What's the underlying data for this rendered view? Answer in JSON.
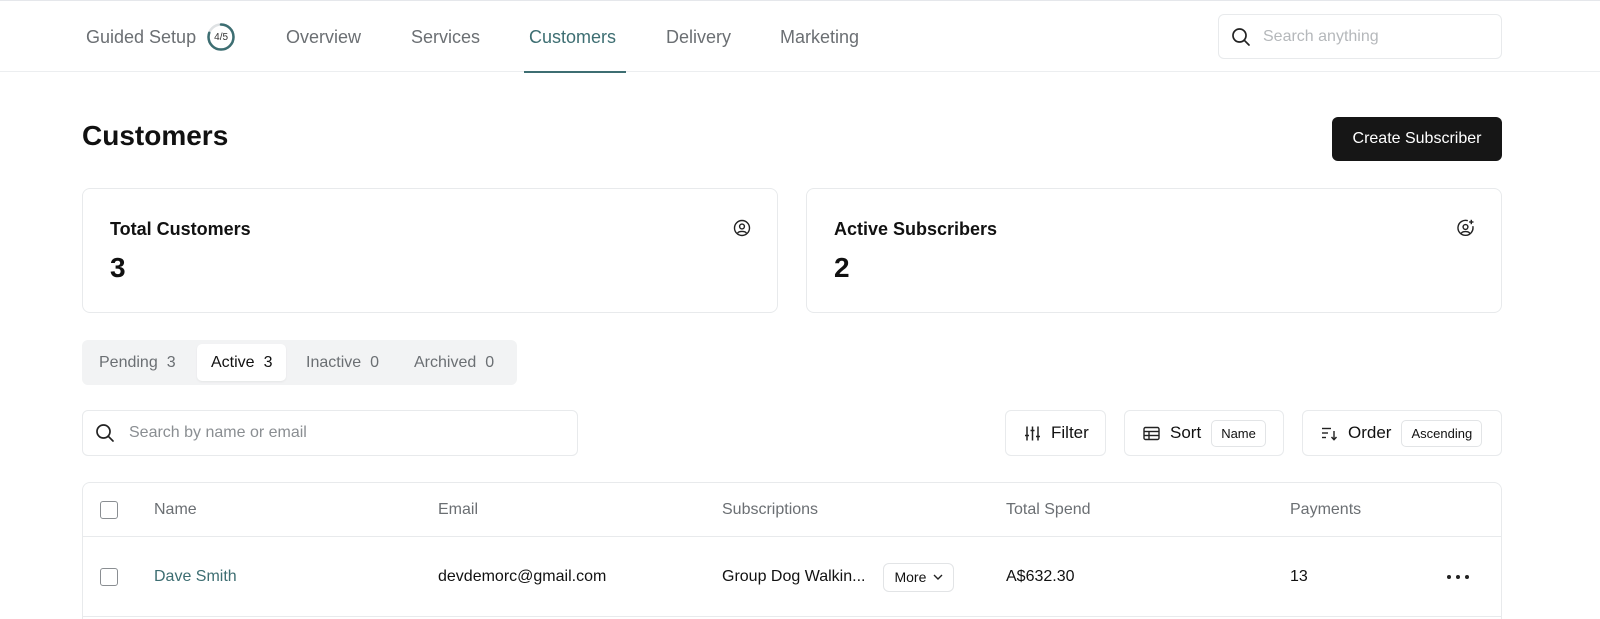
{
  "nav": {
    "guided_setup": "Guided Setup",
    "progress": "4/5",
    "progress_fraction": 0.8,
    "items": [
      {
        "label": "Overview"
      },
      {
        "label": "Services"
      },
      {
        "label": "Customers",
        "active": true
      },
      {
        "label": "Delivery"
      },
      {
        "label": "Marketing"
      }
    ],
    "search_placeholder": "Search anything",
    "accent_color": "#3d6e72"
  },
  "header": {
    "title": "Customers",
    "create_label": "Create Subscriber"
  },
  "stats": [
    {
      "label": "Total Customers",
      "value": "3",
      "icon": "user-circle-icon"
    },
    {
      "label": "Active Subscribers",
      "value": "2",
      "icon": "user-plus-circle-icon"
    }
  ],
  "status_tabs": [
    {
      "label": "Pending",
      "count": "3"
    },
    {
      "label": "Active",
      "count": "3",
      "active": true
    },
    {
      "label": "Inactive",
      "count": "0"
    },
    {
      "label": "Archived",
      "count": "0"
    }
  ],
  "toolbar": {
    "search_placeholder": "Search by name or email",
    "filter_label": "Filter",
    "sort_label": "Sort",
    "sort_value": "Name",
    "order_label": "Order",
    "order_value": "Ascending"
  },
  "table": {
    "columns": [
      "Name",
      "Email",
      "Subscriptions",
      "Total Spend",
      "Payments"
    ],
    "rows": [
      {
        "name": "Dave Smith",
        "email": "devdemorc@gmail.com",
        "subscriptions": "Group Dog Walkin...",
        "more_label": "More",
        "total_spend": "A$632.30",
        "payments": "13"
      }
    ]
  }
}
